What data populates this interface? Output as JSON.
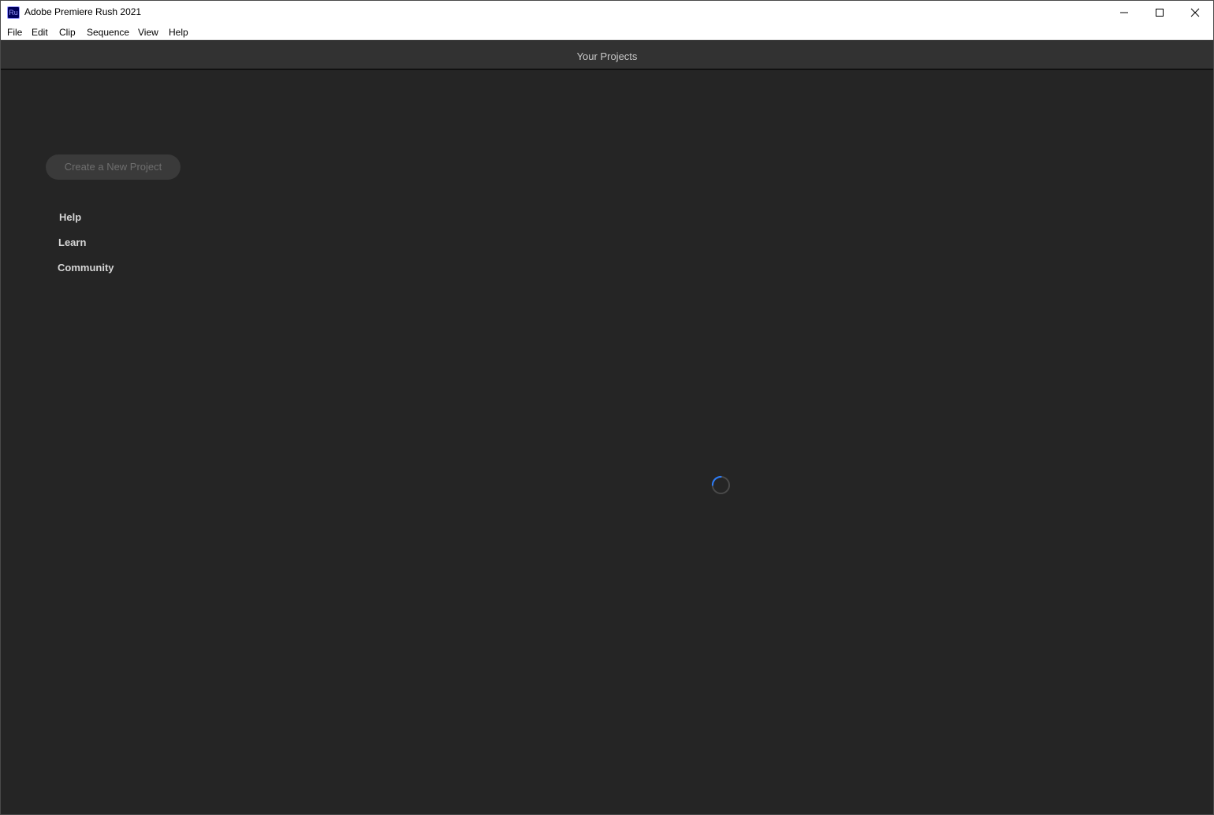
{
  "window": {
    "title": "Adobe Premiere Rush 2021",
    "app_icon_text": "Ru",
    "controls": [
      "minimize-icon",
      "maximize-icon",
      "close-icon"
    ]
  },
  "menubar": {
    "items": [
      "File",
      "Edit",
      "Clip",
      "Sequence",
      "View",
      "Help"
    ]
  },
  "header": {
    "title": "Your Projects"
  },
  "sidebar": {
    "create_button_label": "Create a New Project",
    "links": [
      "Help",
      "Learn",
      "Community"
    ]
  },
  "main": {
    "loading_indicator": "spinner-icon"
  },
  "colors": {
    "background": "#252525",
    "header_bg": "#323232",
    "spinner_accent": "#2d7bf4"
  }
}
